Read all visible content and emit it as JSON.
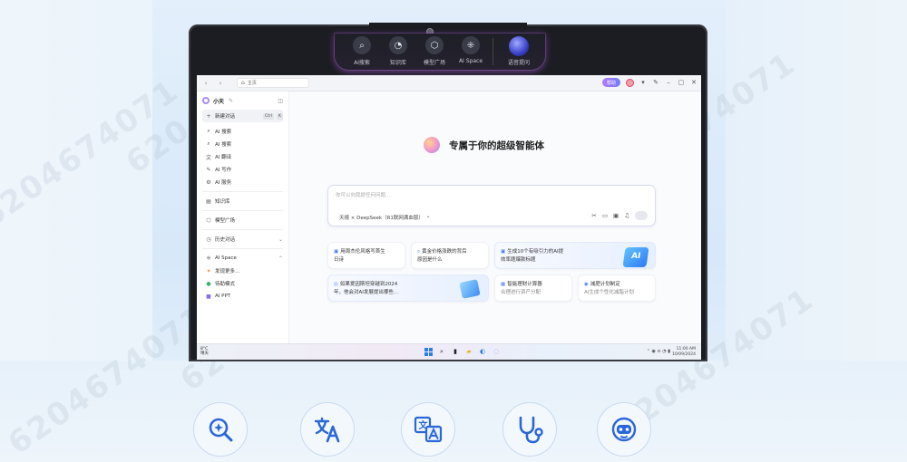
{
  "watermark": "6204674071",
  "dynamic_bar": {
    "items": [
      {
        "label": "AI搜索",
        "icon": "search-spark-icon"
      },
      {
        "label": "知识库",
        "icon": "book-icon"
      },
      {
        "label": "模型广场",
        "icon": "cube-icon"
      },
      {
        "label": "AI Space",
        "icon": "apps-icon"
      }
    ],
    "voice_label": "语音提问"
  },
  "browser": {
    "address": "主页",
    "help_label": "帮助"
  },
  "sidebar": {
    "name": "小天",
    "new_chat": "新建对话",
    "shortcut_keys": [
      "Ctrl",
      "K"
    ],
    "tools": [
      {
        "label": "AI 搜索",
        "icon": "search-icon"
      },
      {
        "label": "AI 搜索",
        "icon": "search-icon"
      },
      {
        "label": "AI 翻译",
        "icon": "translate-icon"
      },
      {
        "label": "AI 写作",
        "icon": "pen-icon"
      },
      {
        "label": "AI 服务",
        "icon": "service-icon"
      }
    ],
    "knowledge": "知识库",
    "model_square": "模型广场",
    "history": "历史对话",
    "ai_space": "AI Space",
    "space_items": [
      "发现更多...",
      "待助模式",
      "AI PPT"
    ]
  },
  "main": {
    "hero_title": "专属于你的超级智能体",
    "input_placeholder": "你可以向我提任何问题...",
    "model_selector": "天禧 × DeepSeek（R1联网满血版）",
    "suggestions": [
      {
        "line1": "用周杰伦风格写首生",
        "line2": "日诗"
      },
      {
        "line1": "黄金价格涨跌的背后",
        "line2": "原因是什么"
      },
      {
        "line1": "生成10个有吸引力的AI提",
        "line2": "效率题爆款标题"
      },
      {
        "line1": "如果爱因斯坦穿越到2024",
        "line2": "年，他会对AI发展提出哪些..."
      },
      {
        "line1": "智能理财计算器",
        "line2": "合理进行资产分配"
      },
      {
        "line1": "减肥计划制定",
        "line2": "AI生成个性化减脂计划"
      }
    ]
  },
  "taskbar": {
    "weather_temp": "8°C",
    "weather_desc": "晴天",
    "time": "11:00 AM",
    "date": "10/09/2024"
  },
  "features": [
    {
      "icon": "search-spark-icon"
    },
    {
      "icon": "translate-icon"
    },
    {
      "icon": "image-translate-icon"
    },
    {
      "icon": "stethoscope-icon"
    },
    {
      "icon": "robot-icon"
    }
  ],
  "colors": {
    "accent": "#2a7de1",
    "purple": "#a98cf2",
    "screen_bg": "#fafbfd"
  }
}
